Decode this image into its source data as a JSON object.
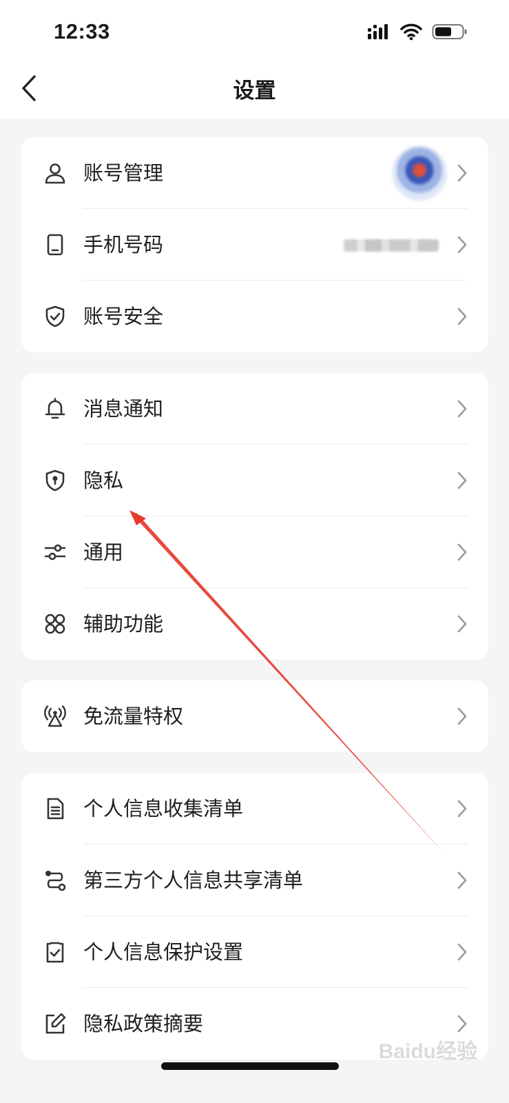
{
  "status_bar": {
    "time": "12:33"
  },
  "header": {
    "title": "设置"
  },
  "groups": [
    {
      "items": [
        {
          "label": "账号管理",
          "icon": "person-icon"
        },
        {
          "label": "手机号码",
          "icon": "phone-icon"
        },
        {
          "label": "账号安全",
          "icon": "shield-check-icon"
        }
      ]
    },
    {
      "items": [
        {
          "label": "消息通知",
          "icon": "bell-icon"
        },
        {
          "label": "隐私",
          "icon": "privacy-shield-icon"
        },
        {
          "label": "通用",
          "icon": "sliders-icon"
        },
        {
          "label": "辅助功能",
          "icon": "apps-icon"
        }
      ]
    },
    {
      "items": [
        {
          "label": "免流量特权",
          "icon": "signal-tower-icon"
        }
      ]
    },
    {
      "items": [
        {
          "label": "个人信息收集清单",
          "icon": "document-list-icon"
        },
        {
          "label": "第三方个人信息共享清单",
          "icon": "share-flow-icon"
        },
        {
          "label": "个人信息保护设置",
          "icon": "clipboard-check-icon"
        },
        {
          "label": "隐私政策摘要",
          "icon": "edit-icon"
        }
      ]
    }
  ],
  "watermark": {
    "text": "Baidu经验"
  },
  "colors": {
    "annotation_arrow": "#e53b2c",
    "background": "#f5f5f5",
    "card": "#ffffff"
  }
}
